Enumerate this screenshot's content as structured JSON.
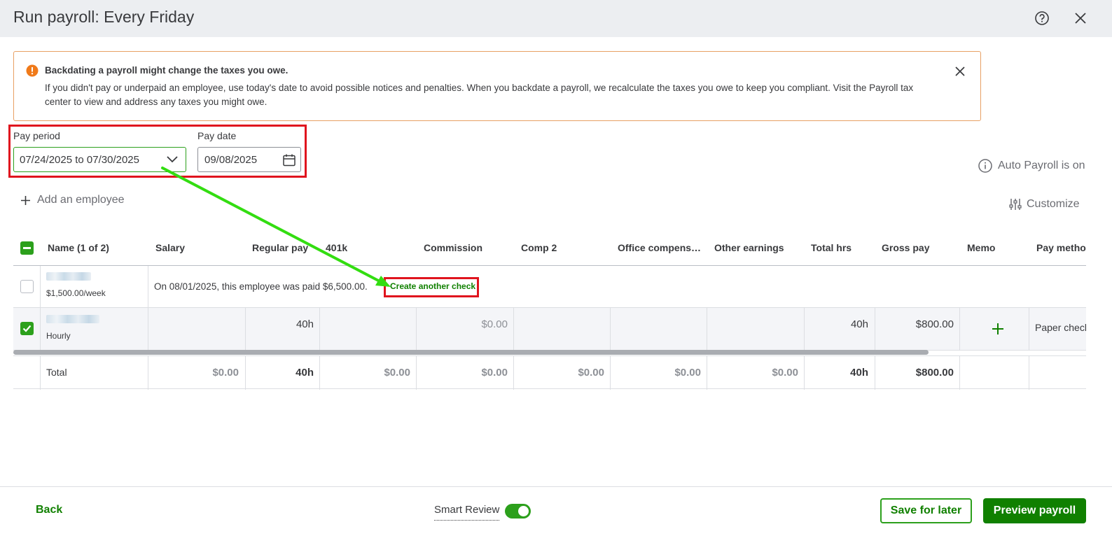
{
  "header": {
    "title": "Run payroll: Every Friday"
  },
  "alert": {
    "title": "Backdating a payroll might change the taxes you owe.",
    "body": "If you didn't pay or underpaid an employee, use today's date to avoid possible notices and penalties. When you backdate a payroll, we recalculate the taxes you owe to keep you compliant. Visit the Payroll tax center to view and address any taxes you might owe."
  },
  "pay_period": {
    "label": "Pay period",
    "value": "07/24/2025 to 07/30/2025"
  },
  "pay_date": {
    "label": "Pay date",
    "value": "09/08/2025"
  },
  "auto_payroll": "Auto Payroll is on",
  "add_employee": "Add an employee",
  "customize": "Customize",
  "columns": [
    "Name (1 of 2)",
    "Salary",
    "Regular pay",
    "401k",
    "Commission",
    "Comp 2",
    "Office compens…",
    "Other earnings",
    "Total hrs",
    "Gross pay",
    "Memo",
    "Pay method"
  ],
  "rows": [
    {
      "rate": "$1,500.00/week",
      "message": "On 08/01/2025, this employee was paid $6,500.00.",
      "action": "Create another check"
    },
    {
      "rate": "Hourly",
      "regular_pay": "40h",
      "commission": "$0.00",
      "total_hrs": "40h",
      "gross_pay": "$800.00",
      "pay_method": "Paper check"
    }
  ],
  "total_row": {
    "label": "Total",
    "salary": "$0.00",
    "regular_pay": "40h",
    "k401": "$0.00",
    "commission": "$0.00",
    "comp2": "$0.00",
    "office": "$0.00",
    "other": "$0.00",
    "total_hrs": "40h",
    "gross_pay": "$800.00"
  },
  "footer": {
    "back": "Back",
    "smart_review": "Smart Review",
    "save_later": "Save for later",
    "preview": "Preview payroll"
  },
  "colors": {
    "brand_green": "#2ca01c",
    "dark_green": "#108000",
    "highlight_red": "#e0141e",
    "annotation_arrow": "#33dd11"
  }
}
